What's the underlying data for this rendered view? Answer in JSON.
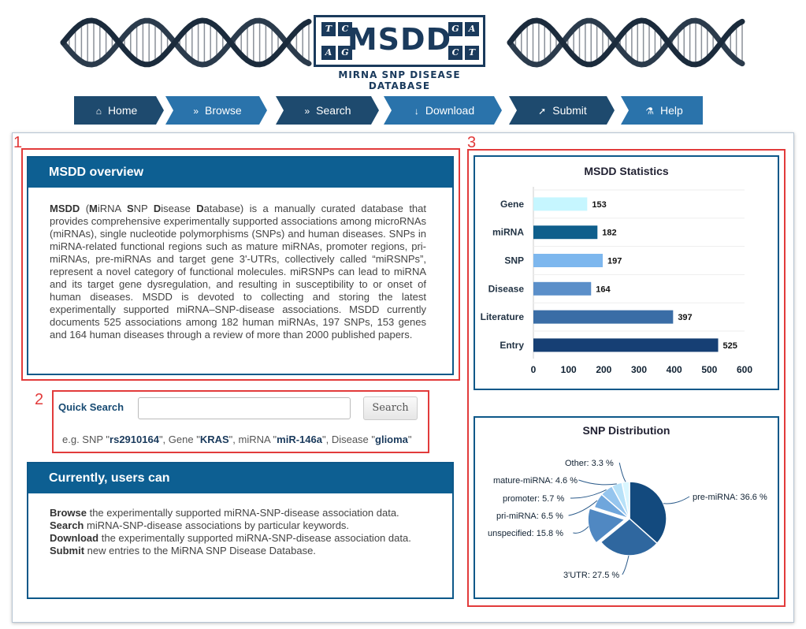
{
  "banner": {
    "logo_text": "MSDD",
    "corners": {
      "tl": "T",
      "tc": "C",
      "bl": "A",
      "bc": "G",
      "tr1": "G",
      "tr2": "A",
      "br1": "C",
      "br2": "T"
    },
    "subtitle": "MIRNA SNP DISEASE DATABASE"
  },
  "nav": {
    "items": [
      {
        "label": "Home",
        "icon": "home-icon",
        "glyph": "⌂"
      },
      {
        "label": "Browse",
        "icon": "double-chevron-right-icon",
        "glyph": "»"
      },
      {
        "label": "Search",
        "icon": "double-chevron-right-icon",
        "glyph": "»"
      },
      {
        "label": "Download",
        "icon": "download-arrow-icon",
        "glyph": "↓"
      },
      {
        "label": "Submit",
        "icon": "rocket-icon",
        "glyph": "➚"
      },
      {
        "label": "Help",
        "icon": "flask-icon",
        "glyph": "⚗"
      }
    ]
  },
  "markers": {
    "one": "1",
    "two": "2",
    "three": "3"
  },
  "overview": {
    "title": "MSDD overview",
    "text_parts": [
      {
        "b": "MSDD"
      },
      {
        "t": " ("
      },
      {
        "b": "M"
      },
      {
        "t": "iRNA "
      },
      {
        "b": "S"
      },
      {
        "t": "NP "
      },
      {
        "b": "D"
      },
      {
        "t": "isease "
      },
      {
        "b": "D"
      },
      {
        "t": "atabase) is a manually curated database that provides comprehensive experimentally supported associations among microRNAs (miRNAs), single nucleotide polymorphisms (SNPs) and human diseases. SNPs in miRNA-related functional regions such as mature miRNAs, promoter regions, pri-miRNAs, pre-miRNAs and target gene 3'-UTRs, collectively called “miRSNPs”, represent a novel category of functional molecules. miRSNPs can lead to miRNA and its target gene dysregulation, and resulting in susceptibility to or onset of human diseases. MSDD is devoted to collecting and storing the latest experimentally supported miRNA–SNP-disease associations. MSDD currently documents 525 associations among 182 human miRNAs, 197 SNPs, 153 genes and 164 human diseases through a review of more than 2000 published papers."
      }
    ]
  },
  "quick_search": {
    "label": "Quick Search",
    "input_value": "",
    "button_label": "Search",
    "examples_prefix": "e.g. SNP \"",
    "ex_snp": "rs2910164",
    "ex_gene_prefix": "\", Gene \"",
    "ex_gene": "KRAS",
    "ex_mirna_prefix": "\", miRNA \"",
    "ex_mirna": "miR-146a",
    "ex_disease_prefix": "\", Disease \"",
    "ex_disease": "glioma",
    "ex_suffix": "\""
  },
  "users": {
    "title": "Currently, users can",
    "lines": [
      {
        "b": "Browse",
        "t": " the experimentally supported miRNA-SNP-disease association data."
      },
      {
        "b": "Search",
        "t": " miRNA-SNP-disease associations by particular keywords."
      },
      {
        "b": "Download",
        "t": " the experimentally supported miRNA-SNP-disease association data."
      },
      {
        "b": "Submit",
        "t": " new entries to the MiRNA SNP Disease Database."
      }
    ]
  },
  "chart_data": [
    {
      "type": "bar",
      "orientation": "horizontal",
      "title": "MSDD Statistics",
      "categories": [
        "Gene",
        "miRNA",
        "SNP",
        "Disease",
        "Literature",
        "Entry"
      ],
      "values": [
        153,
        182,
        197,
        164,
        397,
        525
      ],
      "colors": [
        "#c6f6ff",
        "#0f5f8c",
        "#7db7ee",
        "#5b8fc9",
        "#3a6da6",
        "#163f74"
      ],
      "xlim": [
        0,
        600
      ],
      "xticks": [
        "0",
        "100",
        "200",
        "300",
        "400",
        "500",
        "600"
      ],
      "grid": false
    },
    {
      "type": "pie",
      "title": "SNP Distribution",
      "slices": [
        {
          "label": "pre-miRNA",
          "value": 36.6,
          "text": "pre-miRNA: 36.6 %",
          "color": "#134a7e"
        },
        {
          "label": "3'UTR",
          "value": 27.5,
          "text": "3'UTR: 27.5 %",
          "color": "#2f679f"
        },
        {
          "label": "unspecified",
          "value": 15.8,
          "text": "unspecified: 15.8 %",
          "color": "#5088c2"
        },
        {
          "label": "pri-miRNA",
          "value": 6.5,
          "text": "pri-miRNA: 6.5 %",
          "color": "#6fa6dc"
        },
        {
          "label": "promoter",
          "value": 5.7,
          "text": "promoter: 5.7 %",
          "color": "#95c5ee"
        },
        {
          "label": "mature-miRNA",
          "value": 4.6,
          "text": "mature-miRNA: 4.6 %",
          "color": "#b7e1f8"
        },
        {
          "label": "Other",
          "value": 3.3,
          "text": "Other: 3.3 %",
          "color": "#d9f6ff"
        }
      ]
    }
  ]
}
